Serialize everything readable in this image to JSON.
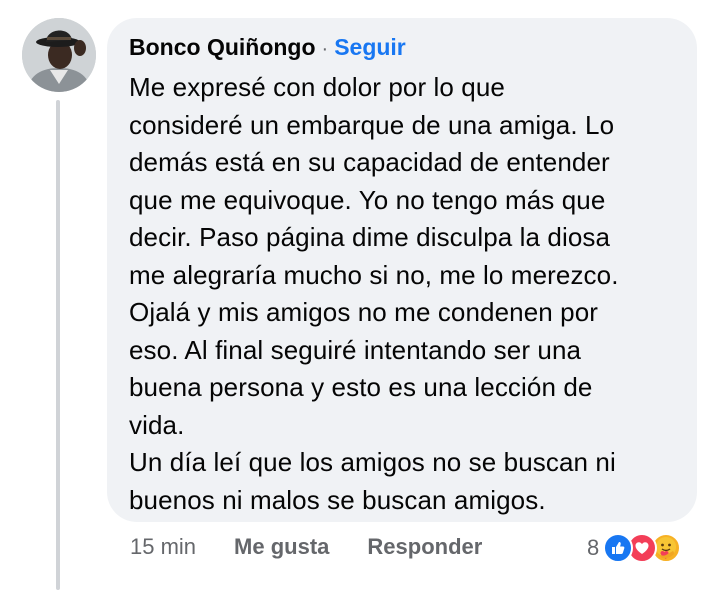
{
  "comment": {
    "author": "Bonco Quiñongo",
    "separator": "·",
    "follow_label": "Seguir",
    "text": "Me expresé con dolor por lo que\nconsideré un embarque de una amiga.  Lo\ndemás está en su capacidad de entender\nque me equivoque. Yo no tengo más que\ndecir. Paso página dime disculpa la diosa\nme alegraría mucho si no, me lo merezco.\nOjalá y mis amigos no me condenen por\neso. Al final seguiré intentando ser una\nbuena persona y esto es una lección de\nvida.\nUn día leí que los amigos no se buscan ni\nbuenos ni malos se buscan amigos."
  },
  "actions": {
    "time": "15 min",
    "like_label": "Me gusta",
    "reply_label": "Responder"
  },
  "reactions": {
    "count": "8",
    "icons": [
      "like-reaction-icon",
      "love-reaction-icon",
      "care-reaction-icon"
    ]
  },
  "colors": {
    "accent": "#1877f2",
    "bubble": "#f0f2f5",
    "muted": "#65676b",
    "text": "#050505"
  }
}
